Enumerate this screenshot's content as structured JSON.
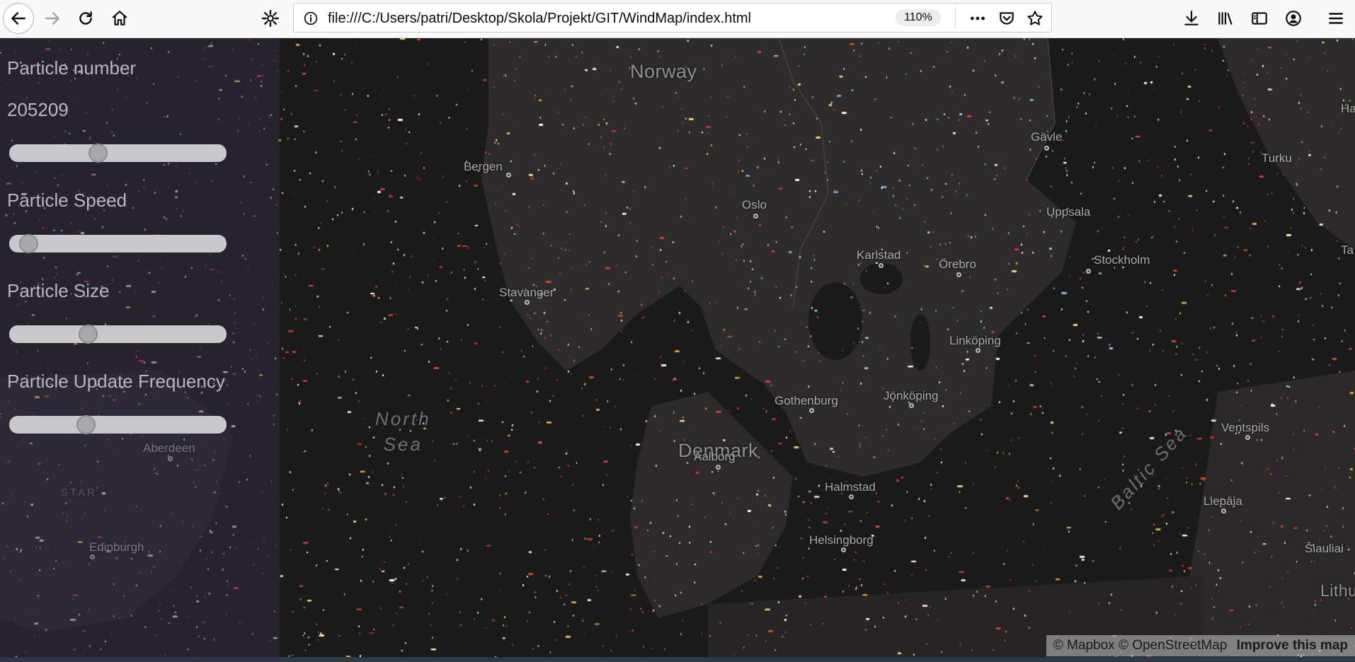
{
  "browser": {
    "url": "file:///C:/Users/patri/Desktop/Skola/Projekt/GIT/WindMap/index.html",
    "zoom": "110%"
  },
  "controls": {
    "particle_number_label": "Particle number",
    "particle_number_value": "205209",
    "particle_number_slider": 0.4,
    "speed_label": "Particle Speed",
    "speed_slider": 0.05,
    "size_label": "Particle Size",
    "size_slider": 0.35,
    "frequency_label": "Particle Update Frequency",
    "frequency_slider": 0.34
  },
  "map": {
    "countries": [
      "Norway",
      "Denmark"
    ],
    "seas": {
      "north_sea_1": "North",
      "north_sea_2": "Sea",
      "baltic": "Baltic Sea"
    },
    "cities": {
      "bergen": "Bergen",
      "oslo": "Oslo",
      "stavanger": "Stavanger",
      "gavle": "Gävle",
      "turku": "Turku",
      "uppsala": "Uppsala",
      "karlstad": "Karlstad",
      "orebro": "Örebro",
      "stockholm": "Stockholm",
      "linkoping": "Linköping",
      "gothenburg": "Gothenburg",
      "jonkoping": "Jönköping",
      "aalborg": "Aalborg",
      "halmstad": "Halmstad",
      "helsingborg": "Helsingborg",
      "ventspils": "Ventspils",
      "liepaja": "Liepāja",
      "siauliai": "Šiauliai",
      "aberdeen": "Aberdeen",
      "edinburgh": "Edinburgh",
      "star": "STAR"
    },
    "partial_labels": {
      "lithu": "Lithu",
      "ta": "Ta",
      "ha": "Ha"
    }
  },
  "attribution": {
    "logo": "mapbox",
    "mapbox": "© Mapbox",
    "osm": "© OpenStreetMap",
    "improve": "Improve this map"
  }
}
